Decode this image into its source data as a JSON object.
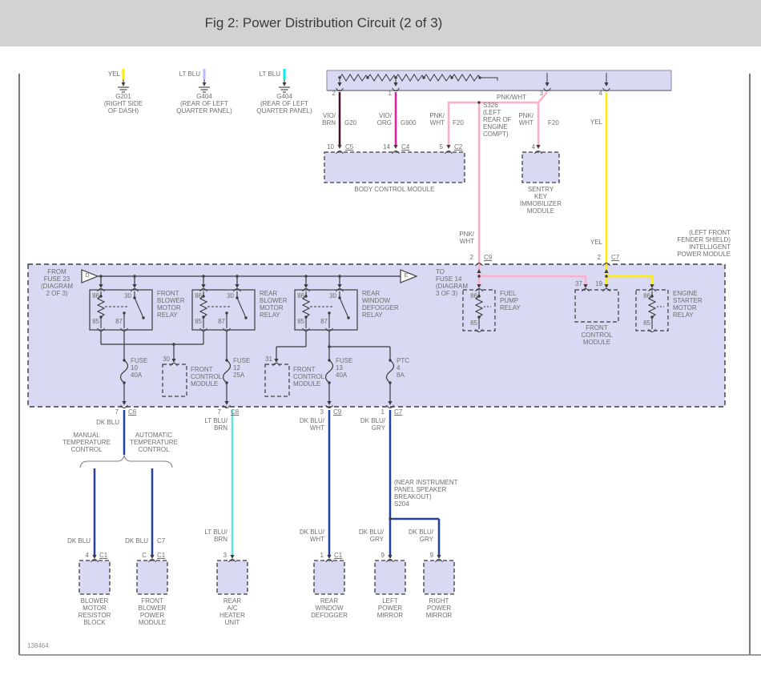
{
  "colors": {
    "header_bg": "#d2d2d2",
    "box_fill": "#d9d9f3",
    "text": "#6f6f6f",
    "line": "#3c3c3c",
    "yellow": "#ffec00",
    "lt_blu_pale": "#b9b9ff",
    "lt_blu_cyan": "#00eeee",
    "vio_brn": "#441031",
    "vio_org": "#f0189c",
    "pnk_wht": "#ffaec8",
    "dk_blu": "#24409e",
    "lt_blu_brn": "#5fe3da"
  },
  "header": {
    "title": "Fig 2: Power Distribution Circuit (2 of 3)"
  },
  "footer": {
    "doc_id": "138464"
  },
  "grounds": [
    {
      "wire": "YEL",
      "label": "G201\n(RIGHT SIDE\nOF DASH)"
    },
    {
      "wire": "LT BLU",
      "label": "G404\n(REAR OF LEFT\nQUARTER PANEL)"
    },
    {
      "wire": "LT BLU",
      "label": "G404\n(REAR OF LEFT\nQUARTER PANEL)"
    }
  ],
  "top_module": {
    "pins": [
      "2",
      "1",
      "3",
      "4"
    ]
  },
  "upper_wires": {
    "w1": {
      "color_label": "VIO/\nBRN",
      "circuit": "G20"
    },
    "w2": {
      "color_label": "VIO/\nORG",
      "circuit": "G900"
    },
    "w3": {
      "color_label": "PNK/\nWHT",
      "circuit": "F20"
    },
    "w4": {
      "color_label": "PNK/\nWHT",
      "circuit": "F20"
    },
    "splice_wire": "PNK/WHT",
    "splice": "S326\n(LEFT\nREAR OF\nENGINE\nCOMPT)",
    "yel": "YEL"
  },
  "bcm": {
    "pins": [
      {
        "pin": "10",
        "conn": "C5"
      },
      {
        "pin": "14",
        "conn": "C4"
      },
      {
        "pin": "5",
        "conn": "C2"
      }
    ],
    "label": "BODY CONTROL MODULE"
  },
  "sentry": {
    "pin": "4",
    "label": "SENTRY\nKEY\nIMMOBILIZER\nMODULE"
  },
  "ipm": {
    "feed_pnk": "PNK/\nWHT",
    "feed_yel": "YEL",
    "module_label": "(LEFT FRONT\nFENDER SHIELD)\nINTELLIGENT\nPOWER MODULE",
    "entries": [
      {
        "pin": "2",
        "conn": "C9"
      },
      {
        "pin": "2",
        "conn": "C7"
      }
    ],
    "from_tag": {
      "letter": "D",
      "label": "FROM\nFUSE 23\n(DIAGRAM\n2 OF 3)"
    },
    "to_tag": {
      "letter": "E",
      "label": "TO\nFUSE 14\n(DIAGRAM\n3 OF 3)"
    },
    "relays": [
      {
        "t86": "86",
        "t30": "30",
        "t85": "85",
        "t87": "87",
        "label": "FRONT\nBLOWER\nMOTOR\nRELAY"
      },
      {
        "t86": "86",
        "t30": "30",
        "t85": "85",
        "t87": "87",
        "label": "REAR\nBLOWER\nMOTOR\nRELAY"
      },
      {
        "t86": "86",
        "t30": "30",
        "t85": "85",
        "t87": "87",
        "label": "REAR\nWINDOW\nDEFOGGER\nRELAY"
      }
    ],
    "fuel": {
      "t86": "86",
      "t85": "85",
      "label": "FUEL\nPUMP\nRELAY"
    },
    "fcm_upper": {
      "p1": "37",
      "p2": "19",
      "label": "FRONT\nCONTROL\nMODULE"
    },
    "starter": {
      "t86": "86",
      "t85": "85",
      "label": "ENGINE\nSTARTER\nMOTOR\nRELAY"
    },
    "fcm_lower1": {
      "pin": "30",
      "label": "FRONT\nCONTROL\nMODULE"
    },
    "fcm_lower2": {
      "pin": "31",
      "label": "FRONT\nCONTROL\nMODULE"
    },
    "fuses": [
      {
        "label": "FUSE\n10\n40A"
      },
      {
        "label": "FUSE\n12\n25A"
      },
      {
        "label": "FUSE\n13\n40A"
      },
      {
        "label": "PTC\n4\n8A"
      }
    ],
    "exits": [
      {
        "pin": "7",
        "conn": "C6"
      },
      {
        "pin": "7",
        "conn": "C8"
      },
      {
        "pin": "3",
        "conn": "C9"
      },
      {
        "pin": "1",
        "conn": "C7"
      }
    ]
  },
  "lower": {
    "dk_blu": "DK BLU",
    "temp_manual": "MANUAL\nTEMPERATURE\nCONTROL",
    "temp_auto": "AUTOMATIC\nTEMPERATURE\nCONTROL",
    "lt_blu_brn": "LT BLU/\nBRN",
    "dk_blu_wht": "DK BLU/\nWHT",
    "dk_blu_gry": "DK BLU/\nGRY",
    "splice": "(NEAR INSTRUMENT\nPANEL SPEAKER\nBREAKOUT)\nS204",
    "branch1": "DK BLU",
    "branch2": "DK BLU",
    "branch2_conn": "C7",
    "lt_blu_brn2": "LT BLU/\nBRN",
    "dk_blu_wht2": "DK BLU/\nWHT",
    "dk_blu_gry_l": "DK BLU/\nGRY",
    "dk_blu_gry_r": "DK BLU/\nGRY"
  },
  "components": [
    {
      "pin": "4",
      "conn": "C1",
      "label": "BLOWER\nMOTOR\nRESISTOR\nBLOCK"
    },
    {
      "pin": "C",
      "conn": "C1",
      "label": "FRONT\nBLOWER\nPOWER\nMODULE"
    },
    {
      "pin": "3",
      "label": "REAR\nA/C\nHEATER\nUNIT"
    },
    {
      "pin": "1",
      "conn": "C1",
      "label": "REAR\nWINDOW\nDEFOGGER"
    },
    {
      "pin": "9",
      "label": "LEFT\nPOWER\nMIRROR"
    },
    {
      "pin": "9",
      "label": "RIGHT\nPOWER\nMIRROR"
    }
  ]
}
